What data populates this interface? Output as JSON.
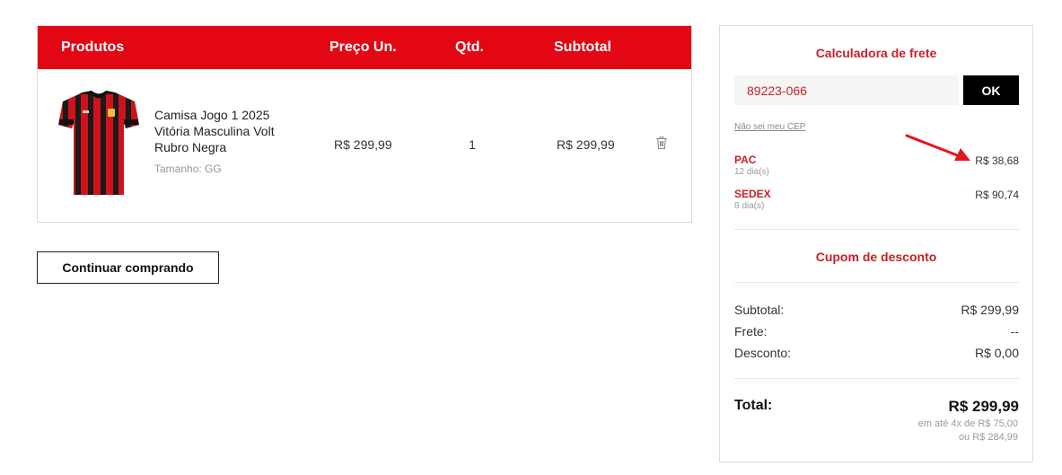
{
  "table": {
    "headers": {
      "products": "Produtos",
      "unit_price": "Preço Un.",
      "qty": "Qtd.",
      "subtotal": "Subtotal"
    },
    "items": [
      {
        "name": "Camisa Jogo 1 2025 Vitória Masculina Volt Rubro Negra",
        "size": "Tamanho: GG",
        "unit_price": "R$ 299,99",
        "qty": "1",
        "subtotal": "R$ 299,99",
        "image_icon": "jersey-red-black-stripes",
        "remove_icon": "trash-icon"
      }
    ]
  },
  "actions": {
    "continue_label": "Continuar comprando"
  },
  "shipping": {
    "title": "Calculadora de frete",
    "cep_value": "89223-066",
    "ok_label": "OK",
    "unknown_cep_link": "Não sei meu CEP",
    "options": [
      {
        "name": "PAC",
        "days": "12 dia(s)",
        "price": "R$ 38,68"
      },
      {
        "name": "SEDEX",
        "days": "8 dia(s)",
        "price": "R$ 90,74"
      }
    ]
  },
  "coupon": {
    "title": "Cupom de desconto"
  },
  "summary": {
    "subtotal_label": "Subtotal:",
    "subtotal_value": "R$ 299,99",
    "freight_label": "Frete:",
    "freight_value": "--",
    "discount_label": "Desconto:",
    "discount_value": "R$ 0,00",
    "total_label": "Total:",
    "total_value": "R$ 299,99",
    "installments": "em até 4x de R$ 75,00",
    "cash_price": "ou R$ 284,99"
  },
  "colors": {
    "brand_red": "#e30613",
    "accent_red": "#c8202a",
    "annotation_arrow": "#e3171c"
  }
}
